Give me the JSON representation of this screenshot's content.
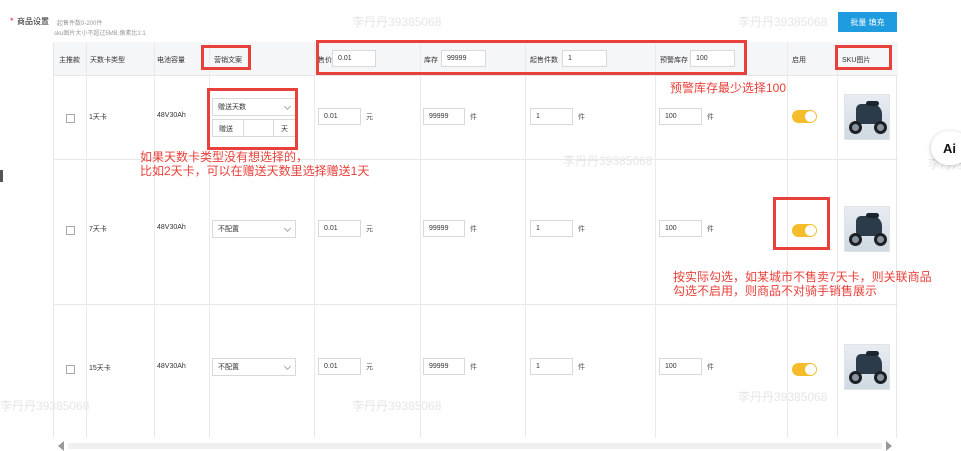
{
  "section": {
    "required_mark": "*",
    "title": "商品设置",
    "hint_range": "起售件数0-200件",
    "hint_image": "sku图片大小不超过5MB,像素比1:1",
    "batch_button": "批量 填充"
  },
  "headers": {
    "main_model": "主推款",
    "card_type": "天数卡类型",
    "battery": "电池容量",
    "marketing": "营销文案",
    "price": "售价",
    "stock": "库存",
    "min_qty": "起售件数",
    "warn_stock": "预警库存",
    "enable": "启用",
    "sku_image": "SKU图片"
  },
  "batch": {
    "price": "0.01",
    "stock": "99999",
    "min_qty": "1",
    "warn_stock": "100"
  },
  "rows": [
    {
      "card_type": "1天卡",
      "battery": "48V30Ah",
      "marketing": "赠送天数",
      "gift_label": "赠送",
      "gift_unit": "天",
      "price": "0.01",
      "price_unit": "元",
      "stock": "99999",
      "stock_unit": "件",
      "min_qty": "1",
      "min_unit": "件",
      "warn": "100",
      "warn_unit": "件"
    },
    {
      "card_type": "7天卡",
      "battery": "48V30Ah",
      "marketing": "不配置",
      "price": "0.01",
      "price_unit": "元",
      "stock": "99999",
      "stock_unit": "件",
      "min_qty": "1",
      "min_unit": "件",
      "warn": "100",
      "warn_unit": "件"
    },
    {
      "card_type": "15天卡",
      "battery": "48V30Ah",
      "marketing": "不配置",
      "price": "0.01",
      "price_unit": "元",
      "stock": "99999",
      "stock_unit": "件",
      "min_qty": "1",
      "min_unit": "件",
      "warn": "100",
      "warn_unit": "件"
    }
  ],
  "annotations": {
    "warn_note": "预警库存最少选择100",
    "card_note_1": "如果天数卡类型没有想选择的，",
    "card_note_2": "比如2天卡，可以在赠送天数里选择赠送1天",
    "enable_note_1": "按实际勾选，如某城市不售卖7天卡，则关联商品",
    "enable_note_2": "勾选不启用，则商品不对骑手销售展示"
  },
  "watermark": "李丹丹39385068",
  "ai_badge": "Ai",
  "colors": {
    "accent": "#1f9be0",
    "toggle_on": "#f5bd2c",
    "annotation": "#e8403a"
  }
}
